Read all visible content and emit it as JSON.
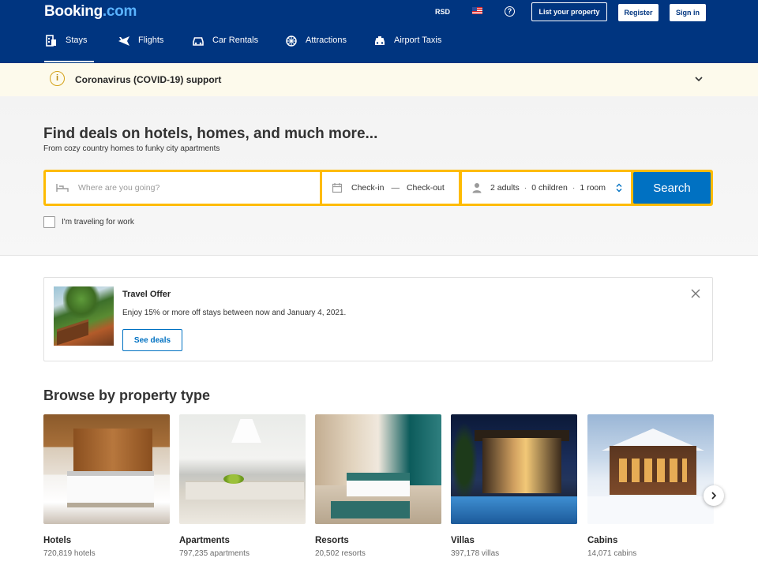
{
  "header": {
    "logo": "Booking",
    "logo_suffix": ".com",
    "currency": "RSD",
    "help_label": "?",
    "list_property": "List your property",
    "register": "Register",
    "sign_in": "Sign in"
  },
  "nav": {
    "items": [
      {
        "label": "Stays",
        "icon": "bed-icon",
        "active": true
      },
      {
        "label": "Flights",
        "icon": "plane-icon",
        "active": false
      },
      {
        "label": "Car Rentals",
        "icon": "car-icon",
        "active": false
      },
      {
        "label": "Attractions",
        "icon": "ferris-wheel-icon",
        "active": false
      },
      {
        "label": "Airport Taxis",
        "icon": "taxi-icon",
        "active": false
      }
    ]
  },
  "covid": {
    "icon_label": "i",
    "text": "Coronavirus (COVID-19) support"
  },
  "hero": {
    "title": "Find deals on hotels, homes, and much more...",
    "subtitle": "From cozy country homes to funky city apartments"
  },
  "search": {
    "destination_placeholder": "Where are you going?",
    "checkin": "Check-in",
    "date_separator": "—",
    "checkout": "Check-out",
    "adults": "2 adults",
    "children": "0 children",
    "rooms": "1 room",
    "guest_separator": "·",
    "button": "Search",
    "work_label": "I'm traveling for work"
  },
  "offer": {
    "title": "Travel Offer",
    "text": "Enjoy 15% or more off stays between now and January 4, 2021.",
    "button": "See deals"
  },
  "browse": {
    "title": "Browse by property type",
    "cards": [
      {
        "name": "Hotels",
        "count": "720,819 hotels"
      },
      {
        "name": "Apartments",
        "count": "797,235 apartments"
      },
      {
        "name": "Resorts",
        "count": "20,502 resorts"
      },
      {
        "name": "Villas",
        "count": "397,178 villas"
      },
      {
        "name": "Cabins",
        "count": "14,071 cabins"
      }
    ]
  },
  "colors": {
    "brand_blue": "#003580",
    "accent_yellow": "#febb02",
    "button_blue": "#0071c2"
  }
}
